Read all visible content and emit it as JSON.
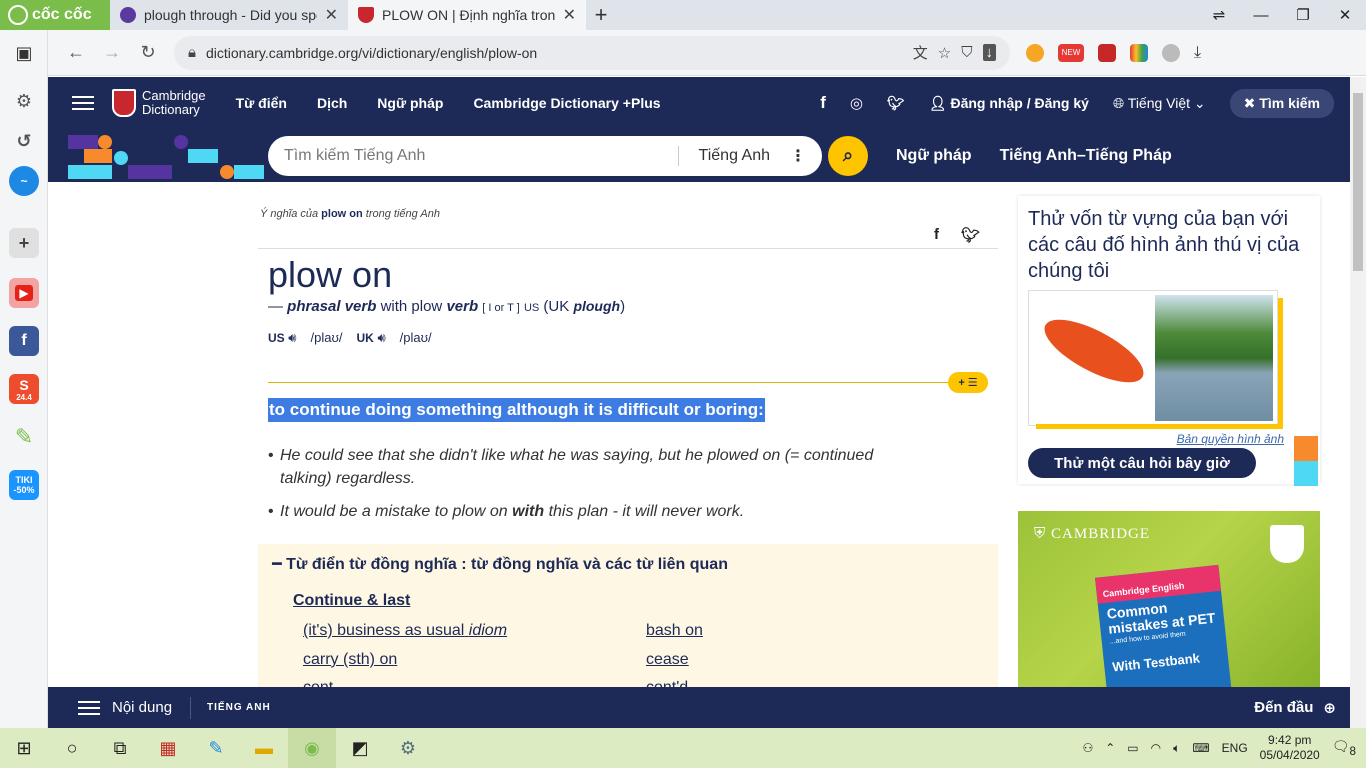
{
  "browser": {
    "brand": "cốc cốc",
    "tabs": [
      {
        "title": "plough through - Did you spe",
        "active": false
      },
      {
        "title": "PLOW ON | Định nghĩa trong",
        "active": true
      }
    ],
    "url": "dictionary.cambridge.org/vi/dictionary/english/plow-on",
    "new_badge": "NEW"
  },
  "sidebar_badges": {
    "shopee": "24.4",
    "tiki": "TIKI",
    "tiki_discount": "-50%"
  },
  "site": {
    "brand_line1": "Cambridge",
    "brand_line2": "Dictionary",
    "nav": [
      "Từ điển",
      "Dịch",
      "Ngữ pháp",
      "Cambridge Dictionary +Plus"
    ],
    "login": "Đăng nhập / Đăng ký",
    "language": "Tiếng Việt",
    "search_btn": "Tìm kiếm",
    "search_placeholder": "Tìm kiếm Tiếng Anh",
    "search_lang": "Tiếng Anh",
    "search_links": [
      "Ngữ pháp",
      "Tiếng Anh–Tiếng Pháp"
    ]
  },
  "entry": {
    "crumb_prefix": "Ý nghĩa của",
    "crumb_word": "plow on",
    "crumb_suffix": "trong tiếng Anh",
    "headword": "plow on",
    "pos_dash": "—",
    "pos": "phrasal verb",
    "pos_with": "with plow",
    "pos_verb": "verb",
    "pos_grammar": "[ I or T ]",
    "pos_region": "US",
    "pos_uk_open": "(UK",
    "pos_uk_word": "plough",
    "pos_uk_close": ")",
    "pron_us_label": "US",
    "pron_us": "/plaʊ/",
    "pron_uk_label": "UK",
    "pron_uk": "/plaʊ/",
    "definition": "to continue doing something although it is difficult or boring:",
    "example1": "He could see that she didn't like what he was saying, but he plowed on (= continued talking) regardless.",
    "example2_a": "It would be a mistake to plow on ",
    "example2_b": "with",
    "example2_c": " this plan - it will never work."
  },
  "thesaurus": {
    "heading": "Từ điển từ đồng nghĩa : từ đồng nghĩa và các từ liên quan",
    "sub": "Continue & last",
    "left": [
      "(it's) business as usual",
      "carry (sth) on",
      "cont..."
    ],
    "left_tag": "idiom",
    "right": [
      "bash on",
      "cease",
      "cont'd"
    ]
  },
  "quiz": {
    "title": "Thử vốn từ vựng của bạn với các câu đố hình ảnh thú vị của chúng tôi",
    "copyright": "Bản quyền hình ảnh",
    "button": "Thử một câu hỏi bây giờ"
  },
  "ad": {
    "brand": "CAMBRIDGE",
    "book_top": "Cambridge English",
    "book_title": "Common mistakes at PET",
    "book_sub": "...and how to avoid them",
    "book_footer": "With Testbank"
  },
  "bottom": {
    "contents": "Nội dung",
    "lang": "TIẾNG ANH",
    "top": "Đến đầu"
  },
  "taskbar": {
    "lang": "ENG",
    "time": "9:42 pm",
    "date": "05/04/2020",
    "notif": "8"
  },
  "colors": {
    "navy": "#1d2a57",
    "yellow": "#fec400",
    "highlight": "#3d7de3",
    "thesaurus_bg": "#fef7e3"
  }
}
